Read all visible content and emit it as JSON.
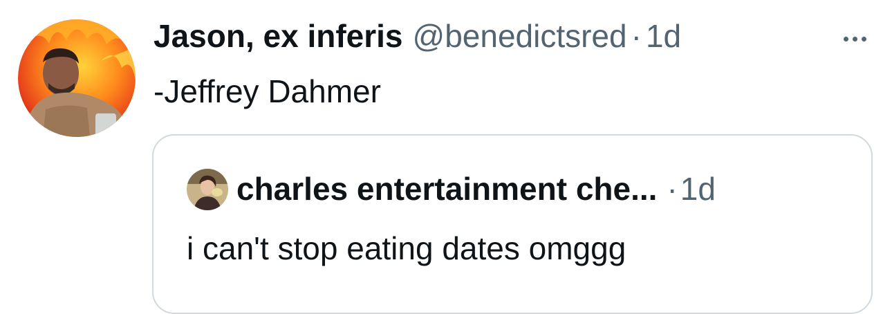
{
  "tweet": {
    "display_name": "Jason, ex inferis",
    "handle": "@benedictsred",
    "separator": "·",
    "time": "1d",
    "text": "-Jeffrey Dahmer",
    "avatar_icon": "profile-photo-fire-background"
  },
  "quote": {
    "display_name": "charles entertainment che...",
    "separator": "·",
    "time": "1d",
    "text": "i can't stop eating dates omggg",
    "avatar_icon": "profile-photo-small"
  },
  "colors": {
    "primary_text": "#0f1419",
    "secondary_text": "#536471",
    "border": "#cfd9de",
    "background": "#ffffff"
  }
}
